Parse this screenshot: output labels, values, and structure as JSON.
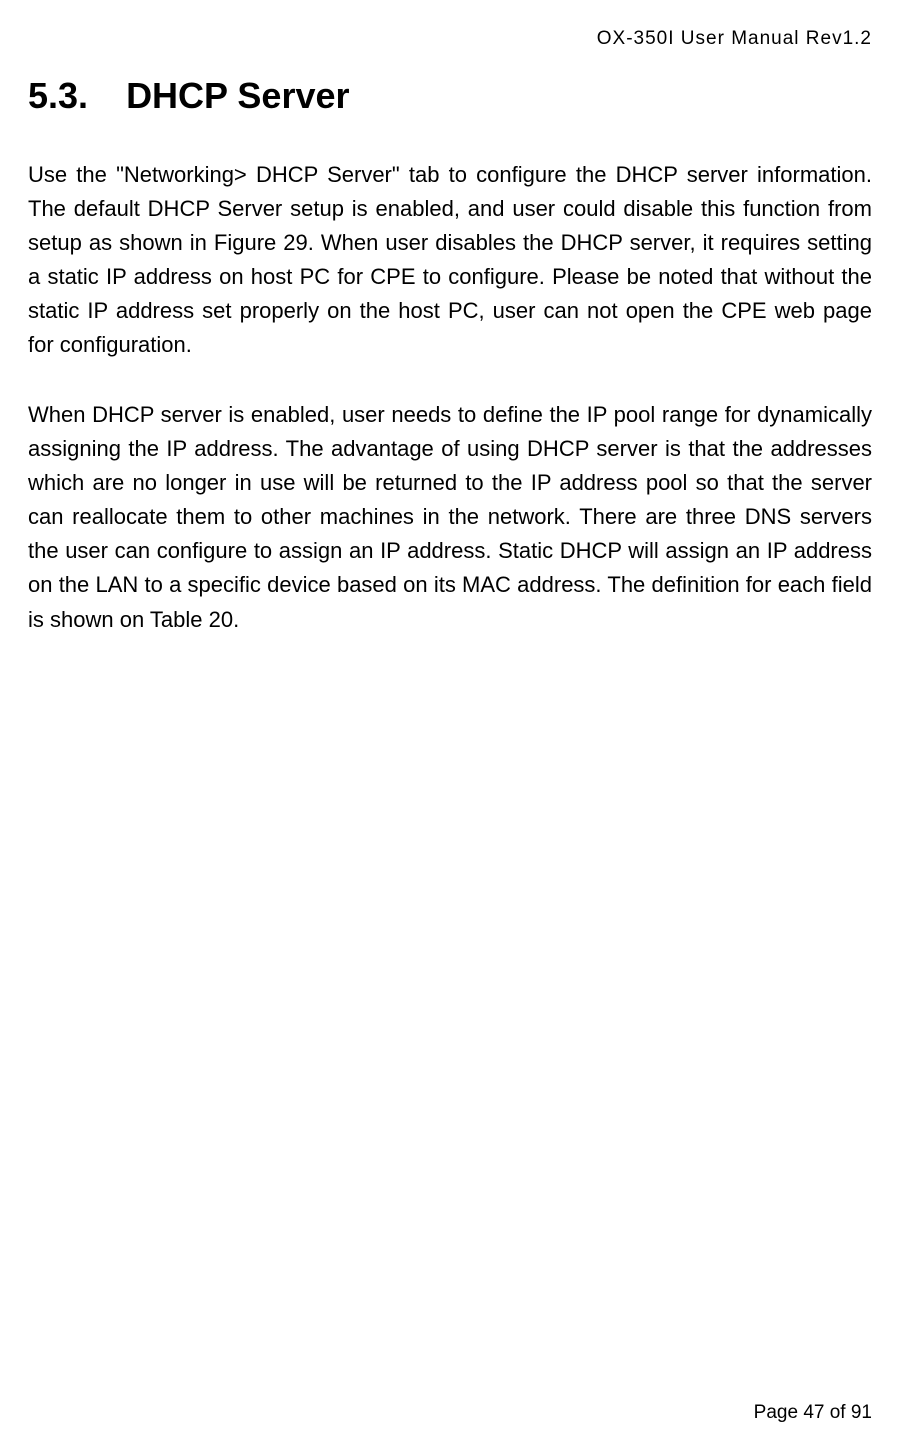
{
  "header": {
    "text": "OX-350I  User  Manual  Rev1.2"
  },
  "section": {
    "number": "5.3.",
    "title": "DHCP Server"
  },
  "paragraphs": {
    "p1": "Use the \"Networking> DHCP Server\" tab to configure the DHCP server information. The default DHCP Server setup is enabled, and user could disable this function from setup as shown in Figure 29. When user disables the DHCP server, it requires setting a static IP address on host PC for CPE to configure. Please be noted that without the static IP address set properly on the host PC, user can not open the CPE web page for configuration.",
    "p2": "When DHCP server is enabled, user needs to define the IP pool range for dynamically assigning the IP address. The advantage of using DHCP server is that the addresses which are no longer in use will be returned to the IP address pool so that the server can reallocate them to other machines in the network. There are three DNS servers the user can configure to assign an IP address. Static DHCP will assign an IP address on the LAN to a specific device based on its MAC address. The definition for each field is shown on Table 20."
  },
  "footer": {
    "text": "Page 47 of 91"
  }
}
